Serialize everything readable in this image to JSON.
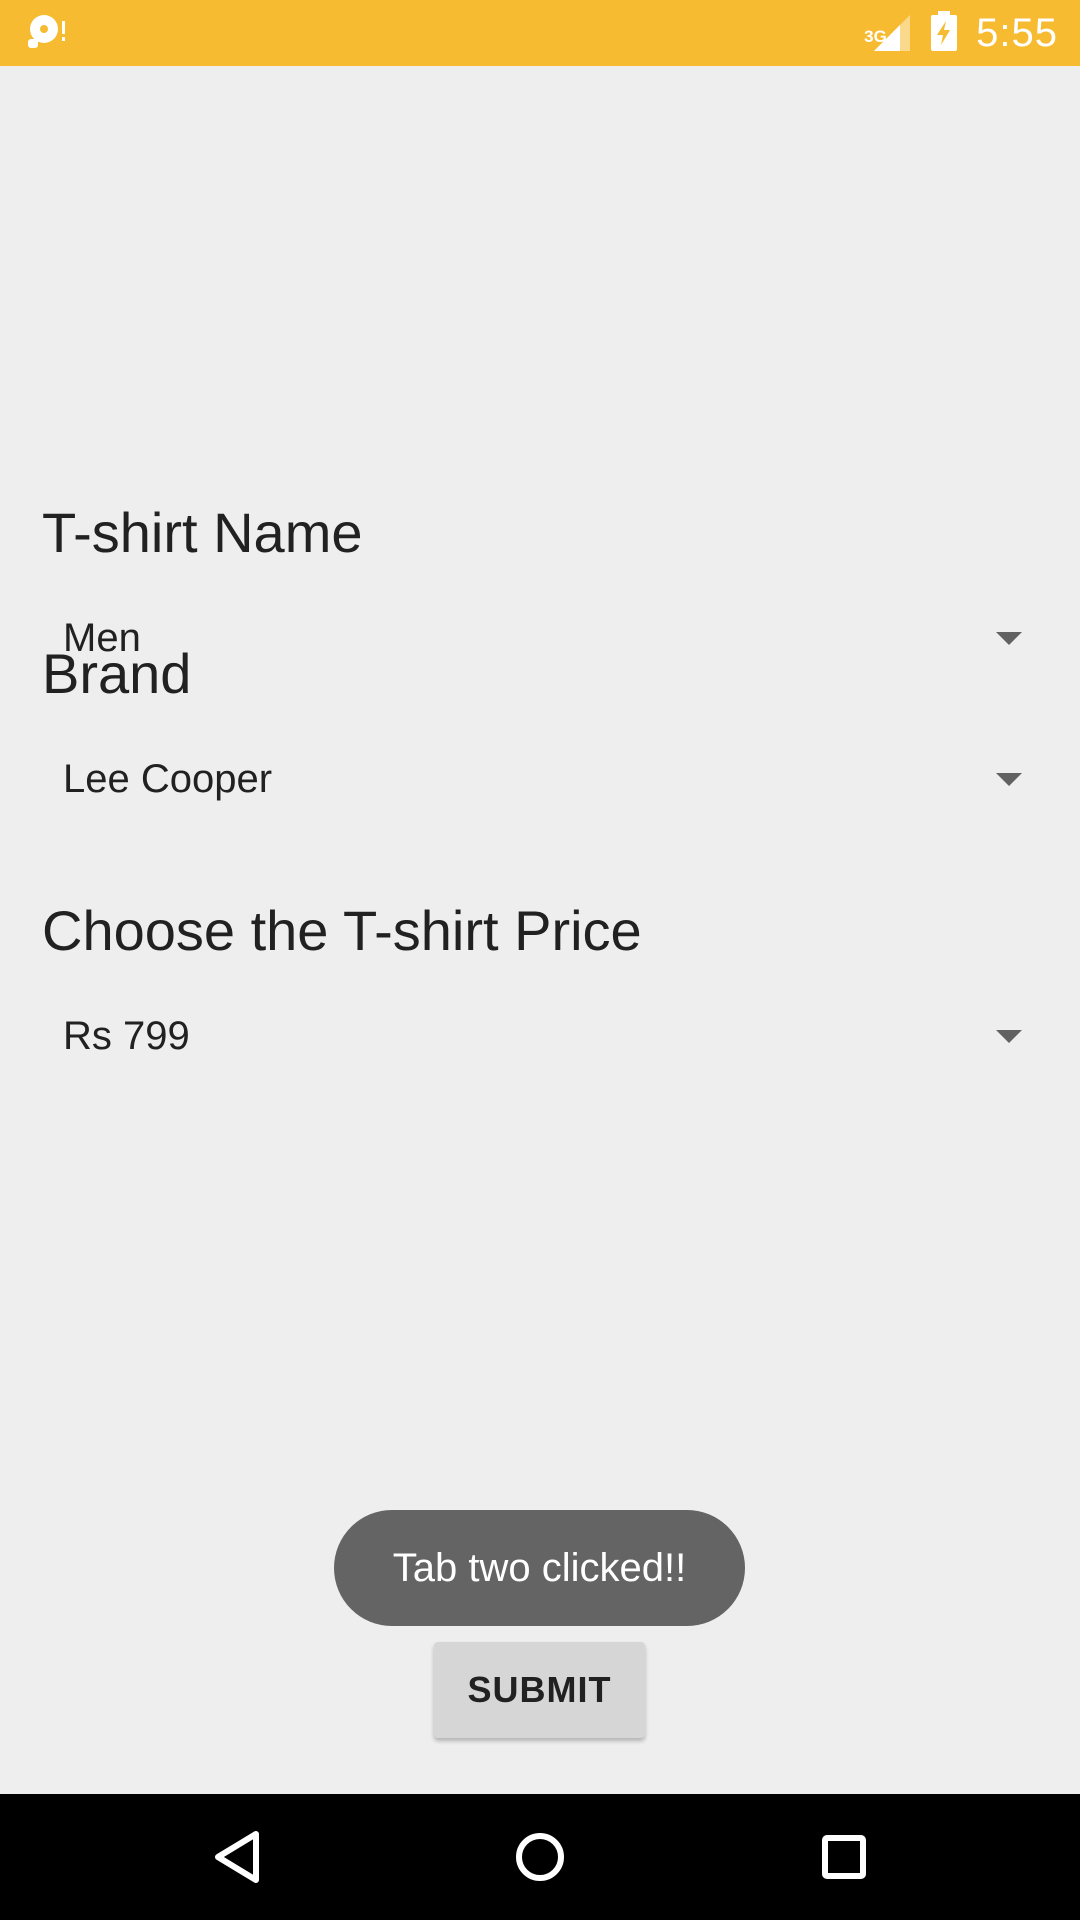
{
  "status_bar": {
    "time": "5:55",
    "network_label": "3G",
    "icons": [
      "notification-icon",
      "signal-icon",
      "battery-charging-icon"
    ],
    "background": "#f6bb31"
  },
  "form": {
    "tshirt_name": {
      "label": "T-shirt Name",
      "value": "Men"
    },
    "brand": {
      "label": "Brand",
      "value": "Lee Cooper"
    },
    "price": {
      "label": "Choose the T-shirt Price",
      "value": "Rs 799"
    }
  },
  "toast": {
    "text": "Tab two clicked!!"
  },
  "actions": {
    "submit_label": "SUBMIT"
  },
  "nav_bar": {
    "icons": [
      "back-icon",
      "home-icon",
      "recents-icon"
    ]
  }
}
